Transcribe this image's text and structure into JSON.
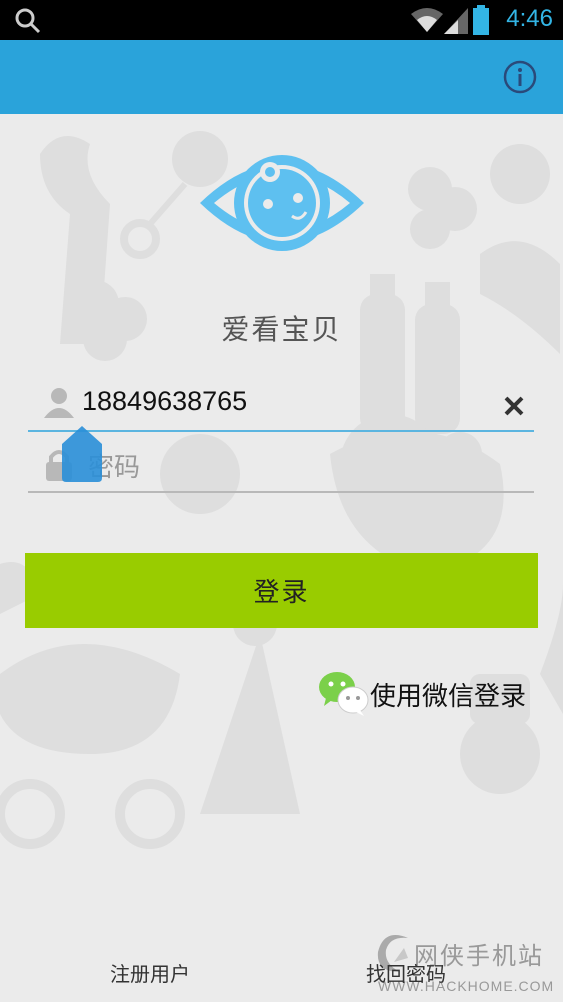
{
  "status_bar": {
    "time": "4:46",
    "icons": [
      "search-icon",
      "wifi-icon",
      "signal-icon",
      "battery-icon"
    ]
  },
  "app_bar": {
    "color": "#2aa3da",
    "info_icon": "info-icon"
  },
  "app": {
    "title": "爱看宝贝"
  },
  "login_form": {
    "phone_value": "18849638765",
    "password_placeholder": "密码",
    "login_label": "登录",
    "login_color": "#99cc00",
    "wechat_label": "使用微信登录"
  },
  "footer": {
    "register_label": "注册用户",
    "forgot_label": "找回密码"
  },
  "watermark": {
    "text": "网侠手机站",
    "url": "WWW.HACKHOME.COM"
  }
}
